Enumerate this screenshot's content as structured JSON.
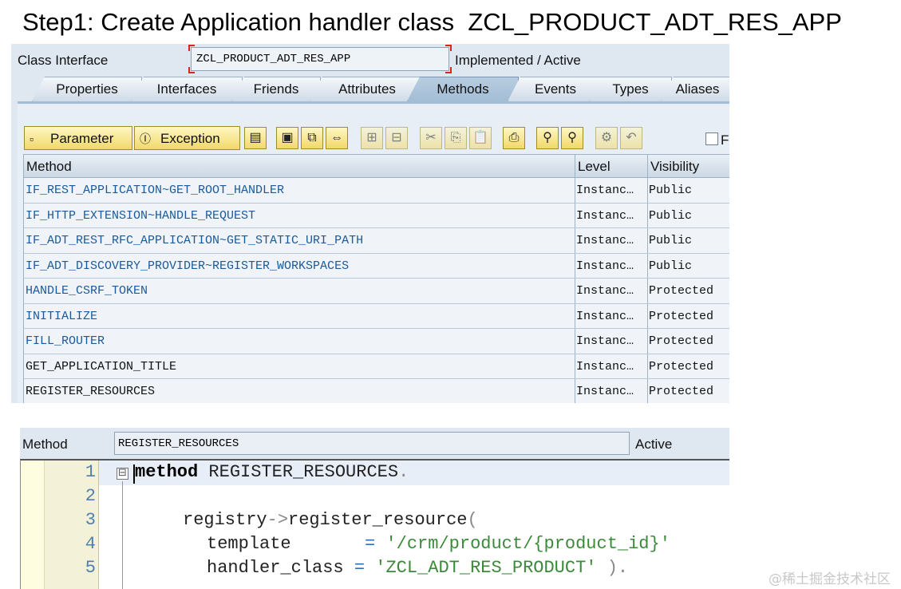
{
  "title": "Step1: Create Application handler class  ZCL_PRODUCT_ADT_RES_APP",
  "class_header": {
    "label": "Class Interface",
    "value": "ZCL_PRODUCT_ADT_RES_APP",
    "status": "Implemented / Active"
  },
  "tabs": [
    "Properties",
    "Interfaces",
    "Friends",
    "Attributes",
    "Methods",
    "Events",
    "Types",
    "Aliases"
  ],
  "active_tab": "Methods",
  "toolbar": {
    "parameter_label": "Parameter",
    "exception_label": "Exception",
    "filter_label": "F"
  },
  "table": {
    "columns": [
      "Method",
      "Level",
      "Visibility"
    ],
    "rows": [
      {
        "method": "IF_REST_APPLICATION~GET_ROOT_HANDLER",
        "level": "Instanc…",
        "visibility": "Public"
      },
      {
        "method": "IF_HTTP_EXTENSION~HANDLE_REQUEST",
        "level": "Instanc…",
        "visibility": "Public"
      },
      {
        "method": "IF_ADT_REST_RFC_APPLICATION~GET_STATIC_URI_PATH",
        "level": "Instanc…",
        "visibility": "Public"
      },
      {
        "method": "IF_ADT_DISCOVERY_PROVIDER~REGISTER_WORKSPACES",
        "level": "Instanc…",
        "visibility": "Public"
      },
      {
        "method": "HANDLE_CSRF_TOKEN",
        "level": "Instanc…",
        "visibility": "Protected"
      },
      {
        "method": "INITIALIZE",
        "level": "Instanc…",
        "visibility": "Protected"
      },
      {
        "method": "FILL_ROUTER",
        "level": "Instanc…",
        "visibility": "Protected"
      },
      {
        "method": "GET_APPLICATION_TITLE",
        "level": "Instanc…",
        "visibility": "Protected"
      },
      {
        "method": "REGISTER_RESOURCES",
        "level": "Instanc…",
        "visibility": "Protected"
      }
    ]
  },
  "method_editor": {
    "label": "Method",
    "value": "REGISTER_RESOURCES",
    "status": "Active",
    "line_numbers": [
      "1",
      "2",
      "3",
      "4",
      "5"
    ],
    "code": {
      "l1_keyword": "method",
      "l1_rest": " REGISTER_RESOURCES",
      "l1_dot": ".",
      "l3_call": "registry",
      "l3_arrow": "->",
      "l3_method": "register_resource",
      "l3_paren": "(",
      "l4_param": "template       ",
      "l4_eq": "=",
      "l4_value": "'/crm/product/{product_id}'",
      "l5_param": "handler_class ",
      "l5_eq": "=",
      "l5_value": "'ZCL_ADT_RES_PRODUCT'",
      "l5_close": " ).",
      "fold_symbol": "⊟"
    }
  },
  "watermark": "@稀土掘金技术社区"
}
